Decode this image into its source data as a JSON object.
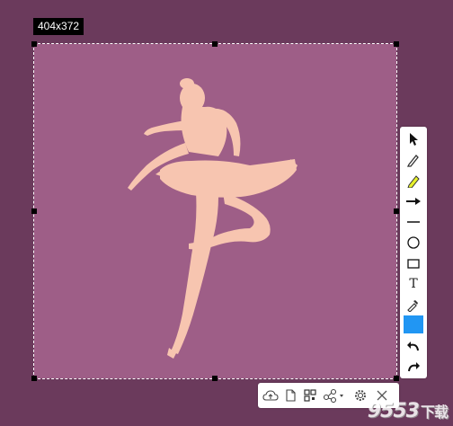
{
  "selection": {
    "size_label": "404x372",
    "fill": "#9e5e87",
    "figure_color": "#f7c5b0"
  },
  "right_toolbar": {
    "tools": [
      {
        "name": "pointer",
        "icon": "cursor-arrow-icon"
      },
      {
        "name": "pen",
        "icon": "pen-icon"
      },
      {
        "name": "highlighter",
        "icon": "highlighter-icon"
      },
      {
        "name": "arrow",
        "icon": "arrow-right-icon"
      },
      {
        "name": "line",
        "icon": "line-icon"
      },
      {
        "name": "ellipse",
        "icon": "circle-icon"
      },
      {
        "name": "rectangle",
        "icon": "rectangle-icon"
      },
      {
        "name": "text",
        "icon": "text-icon",
        "label": "T"
      },
      {
        "name": "color-picker",
        "icon": "eyedropper-icon"
      },
      {
        "name": "color",
        "value": "#2196f3"
      },
      {
        "name": "undo",
        "icon": "undo-icon"
      },
      {
        "name": "redo",
        "icon": "redo-icon"
      }
    ]
  },
  "bottom_toolbar": {
    "actions": [
      {
        "name": "upload",
        "icon": "cloud-upload-icon"
      },
      {
        "name": "copy",
        "icon": "copy-document-icon"
      },
      {
        "name": "qr",
        "icon": "qr-code-icon"
      },
      {
        "name": "share",
        "icon": "share-icon"
      },
      {
        "name": "settings",
        "icon": "gear-icon"
      },
      {
        "name": "close",
        "icon": "close-icon"
      }
    ]
  },
  "watermark": {
    "text": "9553",
    "suffix": "下载"
  }
}
